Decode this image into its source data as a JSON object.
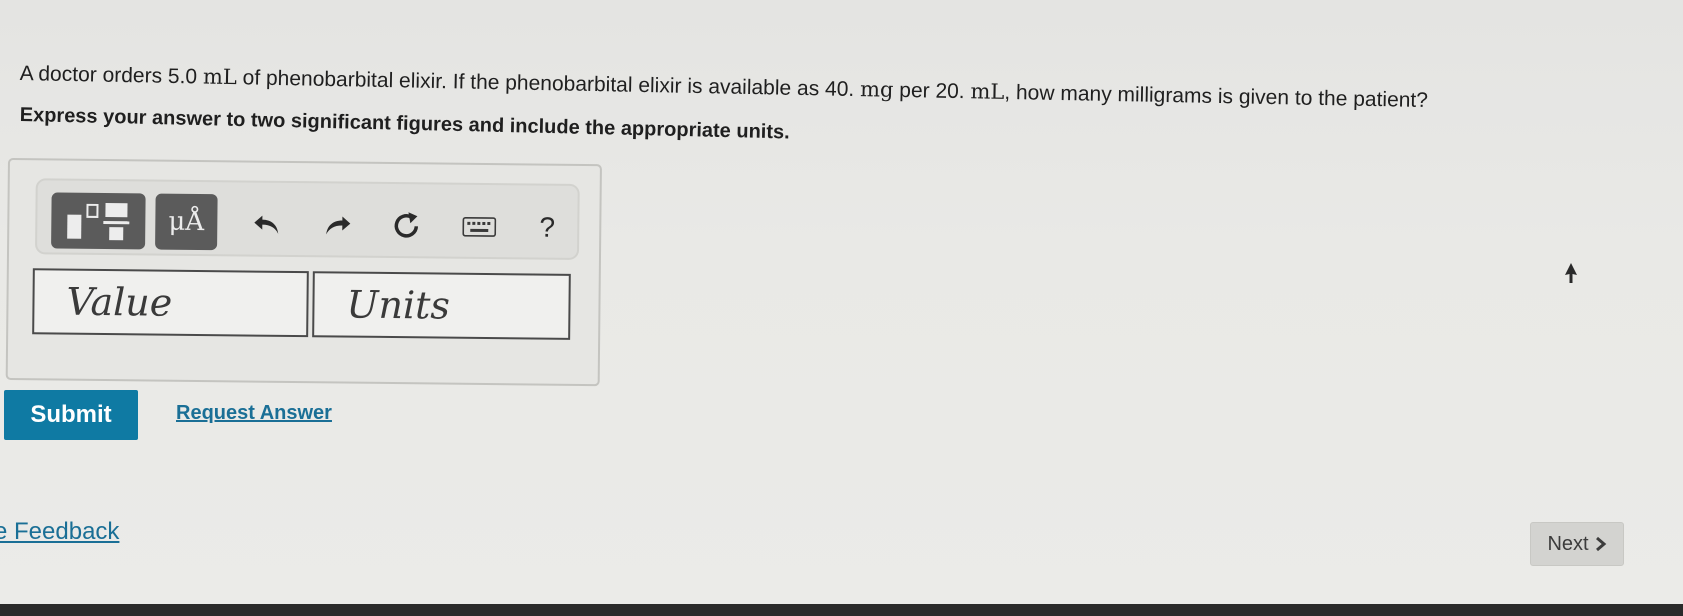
{
  "question": {
    "part1": "A doctor orders 5.0 ",
    "unit1": "mL",
    "part2": " of phenobarbital elixir. If the phenobarbital elixir is available as 40. ",
    "unit2": "mg",
    "part3": " per 20. ",
    "unit3": "mL",
    "part4": ", how many milligrams is given to the patient?"
  },
  "instruction": "Express your answer to two significant figures and include the appropriate units.",
  "toolbar": {
    "templates_icon": "templates-icon",
    "units_label": "μÅ",
    "undo_icon": "undo-icon",
    "redo_icon": "redo-icon",
    "reset_icon": "reset-icon",
    "keyboard_icon": "keyboard-icon",
    "help_label": "?"
  },
  "answer": {
    "value_placeholder": "Value",
    "units_placeholder": "Units"
  },
  "actions": {
    "submit_label": "Submit",
    "request_label": "Request Answer"
  },
  "footer": {
    "feedback_label": "e Feedback",
    "next_label": "Next"
  },
  "colors": {
    "submit_bg": "#0f7aa3",
    "link": "#1a6f96",
    "tool_button": "#5b5b5b"
  }
}
